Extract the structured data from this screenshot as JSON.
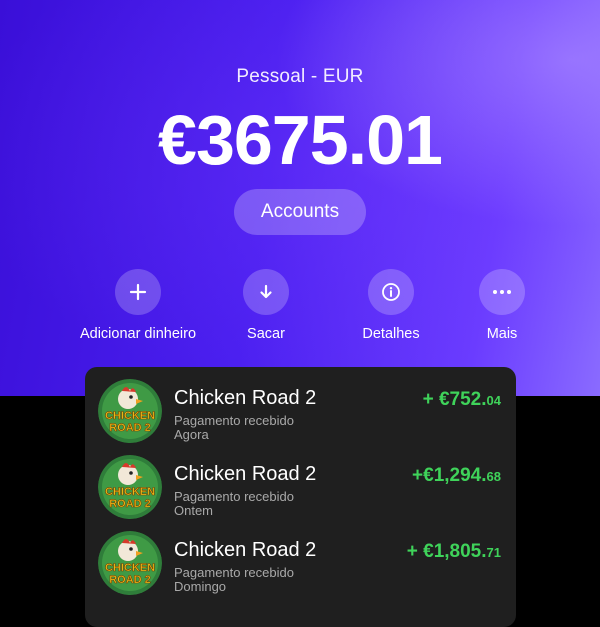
{
  "header": {
    "account_label": "Pessoal - EUR",
    "balance": "€3675.01",
    "accounts_button": "Accounts"
  },
  "actions": [
    {
      "label": "Adicionar dinheiro",
      "icon": "plus-icon"
    },
    {
      "label": "Sacar",
      "icon": "arrow-down-icon"
    },
    {
      "label": "Detalhes",
      "icon": "info-icon"
    },
    {
      "label": "Mais",
      "icon": "more-icon"
    }
  ],
  "transactions": [
    {
      "title": "Chicken Road 2",
      "description": "Pagamento recebido",
      "date": "Agora",
      "amount_main": "+ €752.",
      "amount_cents": "04",
      "logo_text": "CHICKEN ROAD 2"
    },
    {
      "title": "Chicken Road 2",
      "description": "Pagamento recebido",
      "date": "Ontem",
      "amount_main": "+€1,294.",
      "amount_cents": "68",
      "logo_text": "CHICKEN ROAD 2"
    },
    {
      "title": "Chicken Road 2",
      "description": "Pagamento recebido",
      "date": "Domingo",
      "amount_main": "+ €1,805.",
      "amount_cents": "71",
      "logo_text": "CHICKEN ROAD 2"
    }
  ],
  "colors": {
    "hero_primary": "#4a1ff0",
    "card_bg": "#1f1f1f",
    "positive_amount": "#3fd35a"
  }
}
